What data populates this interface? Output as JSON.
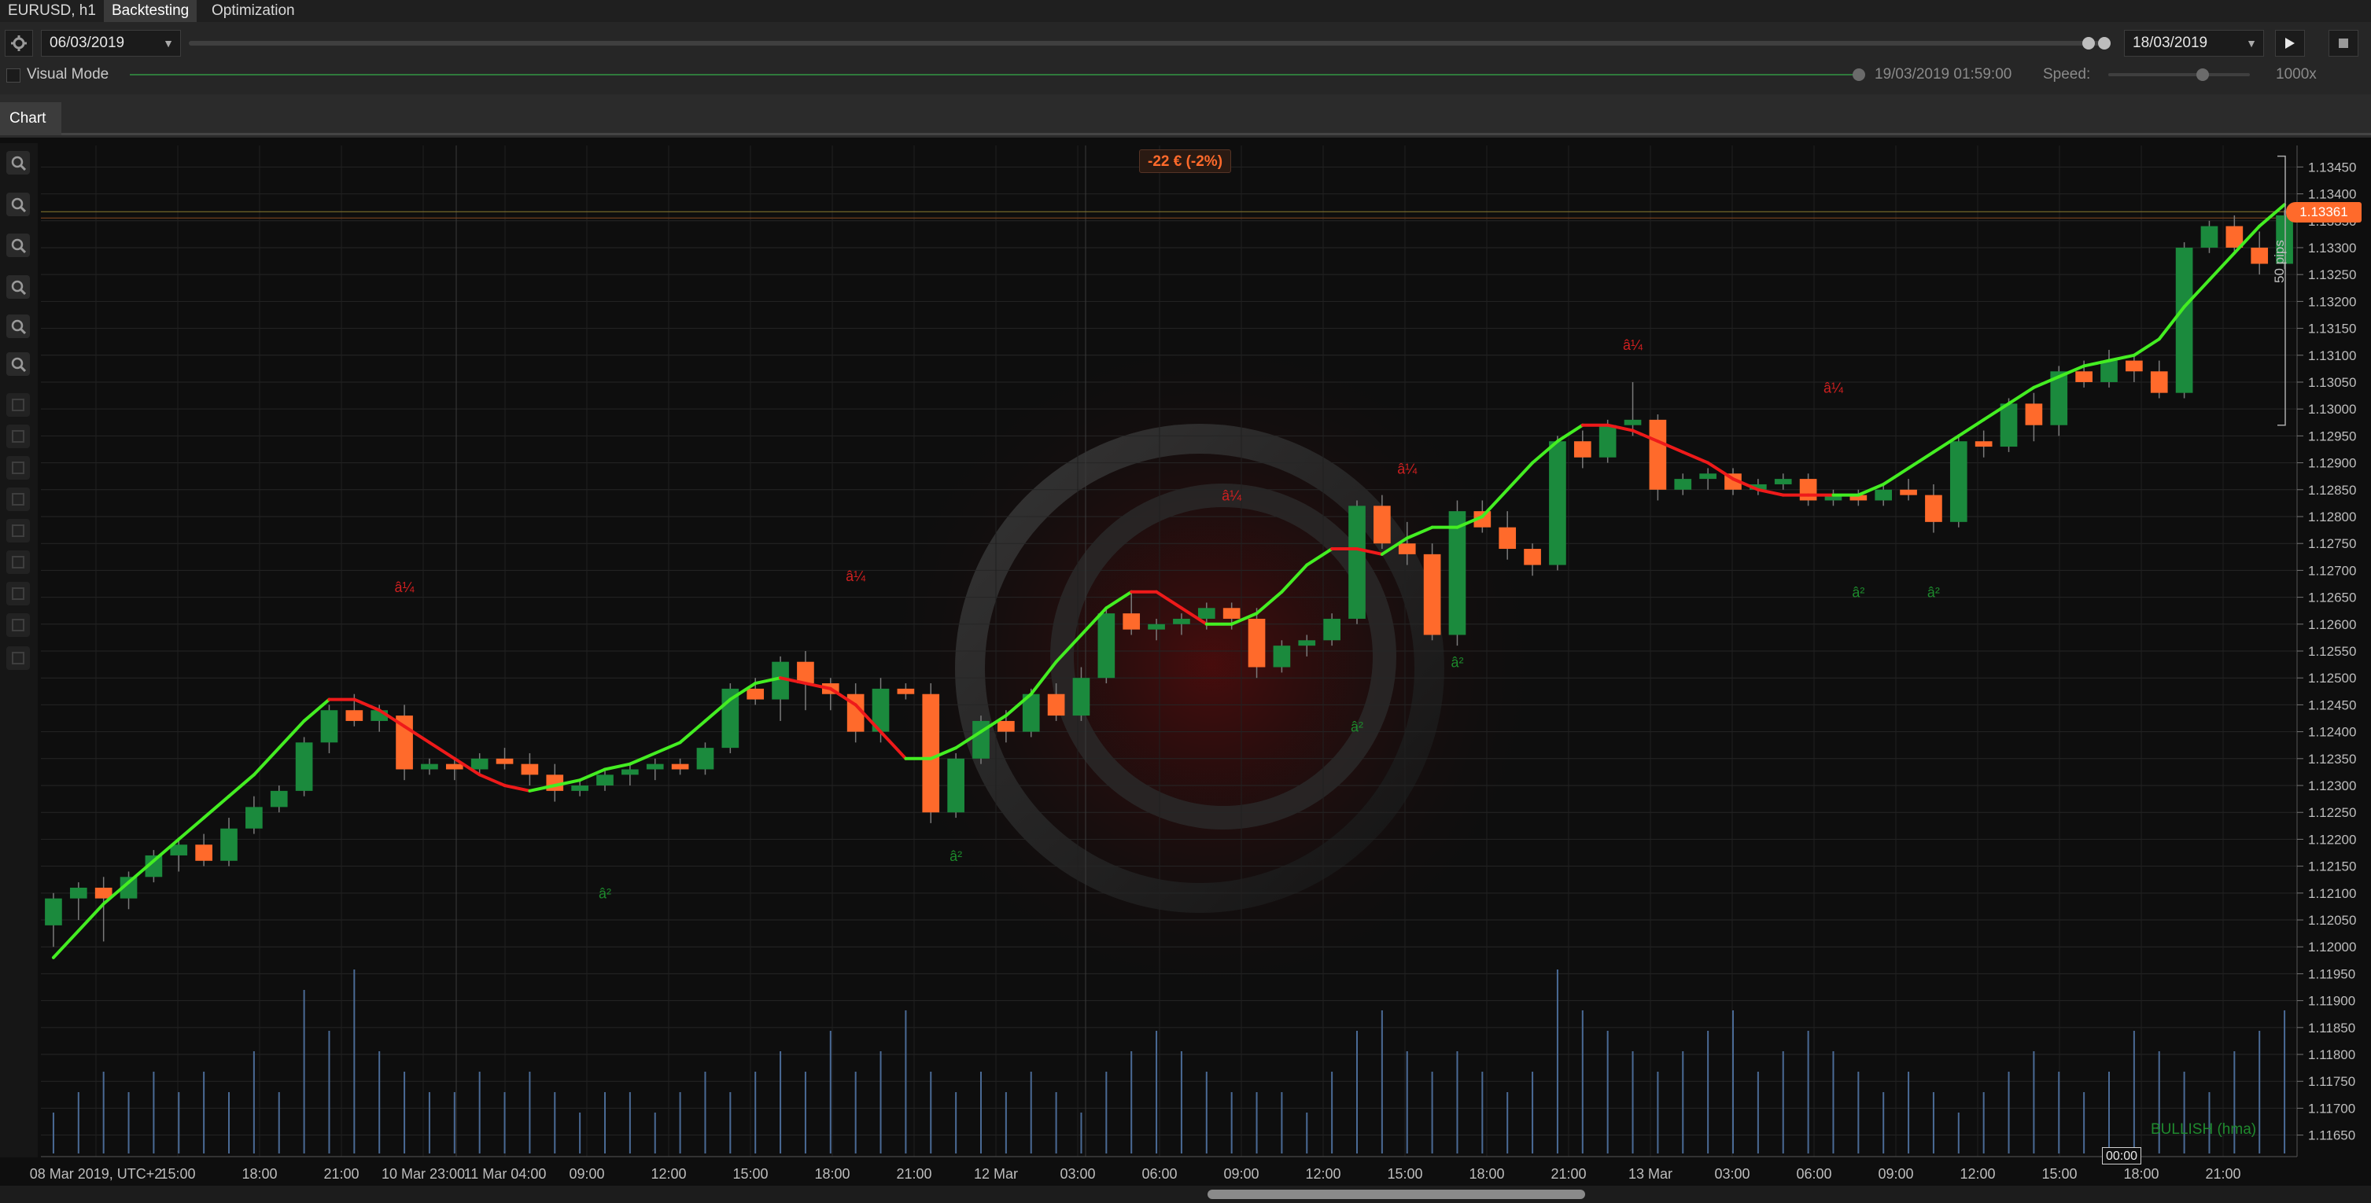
{
  "tabs": {
    "symbol": "EURUSD, h1",
    "backtesting": "Backtesting",
    "optimization": "Optimization"
  },
  "toolbar": {
    "start_date": "06/03/2019",
    "end_date": "18/03/2019",
    "visual_mode": "Visual Mode",
    "visual_mode_checked": false,
    "current_time": "19/03/2019 01:59:00",
    "speed_label": "Speed:",
    "speed_value": "1000x"
  },
  "chart_tab": "Chart",
  "pnl_badge": "-22 € (-2%)",
  "current_price": "1.13361",
  "range_label": "50 pips",
  "indicator_label": "BULLISH (hma)",
  "cursor_time": "00:00",
  "colors": {
    "bull": "#1b8a3d",
    "bear": "#ff6a2b",
    "hma_up": "#44ee22",
    "hma_down": "#ee1a1a",
    "price_badge": "#ff6a2b",
    "bg": "#0e0e0e"
  },
  "sidebar_icons": [
    "zoom-in-icon",
    "zoom-out-icon",
    "crosshair-icon",
    "period-icon",
    "objects-icon",
    "settings-icon",
    "m1-icon",
    "m5-icon",
    "m15-icon",
    "m30-icon",
    "h1-icon",
    "h4-icon",
    "d1-icon",
    "w1-icon",
    "mn-icon"
  ],
  "chart_data": {
    "type": "candlestick",
    "symbol": "EURUSD",
    "timeframe": "h1",
    "ylim": [
      1.1161,
      1.1349
    ],
    "y_ticks": [
      "1.13450",
      "1.13400",
      "1.13350",
      "1.13300",
      "1.13250",
      "1.13200",
      "1.13150",
      "1.13100",
      "1.13050",
      "1.13000",
      "1.12950",
      "1.12900",
      "1.12850",
      "1.12800",
      "1.12750",
      "1.12700",
      "1.12650",
      "1.12600",
      "1.12550",
      "1.12500",
      "1.12450",
      "1.12400",
      "1.12350",
      "1.12300",
      "1.12250",
      "1.12200",
      "1.12150",
      "1.12100",
      "1.12050",
      "1.12000",
      "1.11950",
      "1.11900",
      "1.11850",
      "1.11800",
      "1.11750",
      "1.11700",
      "1.11650"
    ],
    "x_labels": [
      "08 Mar 2019, UTC+2",
      "15:00",
      "18:00",
      "21:00",
      "10 Mar 23:00",
      "11 Mar 04:00",
      "09:00",
      "12:00",
      "15:00",
      "18:00",
      "21:00",
      "12 Mar",
      "03:00",
      "06:00",
      "09:00",
      "12:00",
      "15:00",
      "18:00",
      "21:00",
      "13 Mar",
      "03:00",
      "06:00",
      "09:00",
      "12:00",
      "15:00",
      "18:00",
      "21:00"
    ],
    "candles": [
      [
        1.1204,
        1.121,
        1.12,
        1.1209
      ],
      [
        1.1209,
        1.1212,
        1.1205,
        1.1211
      ],
      [
        1.1211,
        1.1213,
        1.1201,
        1.1209
      ],
      [
        1.1209,
        1.1214,
        1.1207,
        1.1213
      ],
      [
        1.1213,
        1.1218,
        1.1212,
        1.1217
      ],
      [
        1.1217,
        1.122,
        1.1214,
        1.1219
      ],
      [
        1.1219,
        1.1221,
        1.1215,
        1.1216
      ],
      [
        1.1216,
        1.1224,
        1.1215,
        1.1222
      ],
      [
        1.1222,
        1.1228,
        1.1221,
        1.1226
      ],
      [
        1.1226,
        1.123,
        1.1225,
        1.1229
      ],
      [
        1.1229,
        1.1239,
        1.1228,
        1.1238
      ],
      [
        1.1238,
        1.1245,
        1.1236,
        1.1244
      ],
      [
        1.1244,
        1.1247,
        1.1241,
        1.1242
      ],
      [
        1.1242,
        1.1245,
        1.124,
        1.1244
      ],
      [
        1.1243,
        1.1245,
        1.1231,
        1.1233
      ],
      [
        1.1233,
        1.1235,
        1.1232,
        1.1234
      ],
      [
        1.1234,
        1.1235,
        1.1231,
        1.1233
      ],
      [
        1.1233,
        1.1236,
        1.1232,
        1.1235
      ],
      [
        1.1235,
        1.1237,
        1.1233,
        1.1234
      ],
      [
        1.1234,
        1.1236,
        1.123,
        1.1232
      ],
      [
        1.1232,
        1.1234,
        1.1227,
        1.1229
      ],
      [
        1.1229,
        1.1231,
        1.1228,
        1.123
      ],
      [
        1.123,
        1.1233,
        1.1229,
        1.1232
      ],
      [
        1.1232,
        1.1234,
        1.123,
        1.1233
      ],
      [
        1.1233,
        1.1235,
        1.1231,
        1.1234
      ],
      [
        1.1234,
        1.1235,
        1.1232,
        1.1233
      ],
      [
        1.1233,
        1.1238,
        1.1232,
        1.1237
      ],
      [
        1.1237,
        1.1249,
        1.1236,
        1.1248
      ],
      [
        1.1248,
        1.125,
        1.1245,
        1.1246
      ],
      [
        1.1246,
        1.1254,
        1.1242,
        1.1253
      ],
      [
        1.1253,
        1.1255,
        1.1244,
        1.1249
      ],
      [
        1.1249,
        1.125,
        1.1244,
        1.1247
      ],
      [
        1.1247,
        1.1249,
        1.1238,
        1.124
      ],
      [
        1.124,
        1.125,
        1.1238,
        1.1248
      ],
      [
        1.1248,
        1.1249,
        1.1246,
        1.1247
      ],
      [
        1.1247,
        1.1249,
        1.1223,
        1.1225
      ],
      [
        1.1225,
        1.1236,
        1.1224,
        1.1235
      ],
      [
        1.1235,
        1.1243,
        1.1234,
        1.1242
      ],
      [
        1.1242,
        1.1244,
        1.1238,
        1.124
      ],
      [
        1.124,
        1.1248,
        1.1239,
        1.1247
      ],
      [
        1.1247,
        1.1249,
        1.1242,
        1.1243
      ],
      [
        1.1243,
        1.1252,
        1.1242,
        1.125
      ],
      [
        1.125,
        1.1263,
        1.1249,
        1.1262
      ],
      [
        1.1262,
        1.1266,
        1.1258,
        1.1259
      ],
      [
        1.1259,
        1.1261,
        1.1257,
        1.126
      ],
      [
        1.126,
        1.1262,
        1.1258,
        1.1261
      ],
      [
        1.1261,
        1.1264,
        1.1259,
        1.1263
      ],
      [
        1.1263,
        1.1264,
        1.1259,
        1.1261
      ],
      [
        1.1261,
        1.1263,
        1.125,
        1.1252
      ],
      [
        1.1252,
        1.1257,
        1.1251,
        1.1256
      ],
      [
        1.1256,
        1.1258,
        1.1254,
        1.1257
      ],
      [
        1.1257,
        1.1262,
        1.1256,
        1.1261
      ],
      [
        1.1261,
        1.1283,
        1.126,
        1.1282
      ],
      [
        1.1282,
        1.1284,
        1.1274,
        1.1275
      ],
      [
        1.1275,
        1.1279,
        1.1271,
        1.1273
      ],
      [
        1.1273,
        1.1275,
        1.1257,
        1.1258
      ],
      [
        1.1258,
        1.1283,
        1.1256,
        1.1281
      ],
      [
        1.1281,
        1.1283,
        1.1277,
        1.1278
      ],
      [
        1.1278,
        1.1281,
        1.1272,
        1.1274
      ],
      [
        1.1274,
        1.1275,
        1.1269,
        1.1271
      ],
      [
        1.1271,
        1.1295,
        1.127,
        1.1294
      ],
      [
        1.1294,
        1.1296,
        1.1289,
        1.1291
      ],
      [
        1.1291,
        1.1298,
        1.129,
        1.1297
      ],
      [
        1.1297,
        1.1305,
        1.1295,
        1.1298
      ],
      [
        1.1298,
        1.1299,
        1.1283,
        1.1285
      ],
      [
        1.1285,
        1.1288,
        1.1284,
        1.1287
      ],
      [
        1.1287,
        1.1289,
        1.1285,
        1.1288
      ],
      [
        1.1288,
        1.1289,
        1.1284,
        1.1285
      ],
      [
        1.1285,
        1.1287,
        1.1284,
        1.1286
      ],
      [
        1.1286,
        1.1288,
        1.1285,
        1.1287
      ],
      [
        1.1287,
        1.1288,
        1.1282,
        1.1283
      ],
      [
        1.1283,
        1.1285,
        1.1282,
        1.1284
      ],
      [
        1.1284,
        1.1285,
        1.1282,
        1.1283
      ],
      [
        1.1283,
        1.1286,
        1.1282,
        1.1285
      ],
      [
        1.1285,
        1.1287,
        1.1283,
        1.1284
      ],
      [
        1.1284,
        1.1286,
        1.1277,
        1.1279
      ],
      [
        1.1279,
        1.1295,
        1.1278,
        1.1294
      ],
      [
        1.1294,
        1.1296,
        1.1291,
        1.1293
      ],
      [
        1.1293,
        1.1302,
        1.1292,
        1.1301
      ],
      [
        1.1301,
        1.1303,
        1.1294,
        1.1297
      ],
      [
        1.1297,
        1.1308,
        1.1295,
        1.1307
      ],
      [
        1.1307,
        1.1309,
        1.1304,
        1.1305
      ],
      [
        1.1305,
        1.1311,
        1.1304,
        1.1309
      ],
      [
        1.1309,
        1.131,
        1.1305,
        1.1307
      ],
      [
        1.1307,
        1.1309,
        1.1302,
        1.1303
      ],
      [
        1.1303,
        1.1331,
        1.1302,
        1.133
      ],
      [
        1.133,
        1.1335,
        1.1329,
        1.1334
      ],
      [
        1.1334,
        1.1336,
        1.1329,
        1.133
      ],
      [
        1.133,
        1.1333,
        1.1325,
        1.1327
      ],
      [
        1.1327,
        1.1337,
        1.1326,
        1.1336
      ]
    ],
    "volume": [
      0.2,
      0.3,
      0.4,
      0.3,
      0.4,
      0.3,
      0.4,
      0.3,
      0.5,
      0.3,
      0.8,
      0.6,
      0.9,
      0.5,
      0.4,
      0.3,
      0.3,
      0.4,
      0.3,
      0.4,
      0.3,
      0.2,
      0.3,
      0.3,
      0.2,
      0.3,
      0.4,
      0.3,
      0.4,
      0.5,
      0.4,
      0.6,
      0.4,
      0.5,
      0.7,
      0.4,
      0.3,
      0.4,
      0.3,
      0.4,
      0.3,
      0.2,
      0.4,
      0.5,
      0.6,
      0.5,
      0.4,
      0.3,
      0.3,
      0.3,
      0.2,
      0.4,
      0.6,
      0.7,
      0.5,
      0.4,
      0.5,
      0.4,
      0.3,
      0.4,
      0.9,
      0.7,
      0.6,
      0.5,
      0.4,
      0.5,
      0.6,
      0.7,
      0.4,
      0.5,
      0.6,
      0.5,
      0.4,
      0.3,
      0.4,
      0.3,
      0.2,
      0.3,
      0.4,
      0.5,
      0.4,
      0.3,
      0.4,
      0.6,
      0.5,
      0.4,
      0.3,
      0.5,
      0.6,
      0.7
    ],
    "hma": [
      1.1198,
      1.1203,
      1.1208,
      1.1212,
      1.1216,
      1.122,
      1.1224,
      1.1228,
      1.1232,
      1.1237,
      1.1242,
      1.1246,
      1.1246,
      1.1244,
      1.1241,
      1.1238,
      1.1235,
      1.1232,
      1.123,
      1.1229,
      1.123,
      1.1231,
      1.1233,
      1.1234,
      1.1236,
      1.1238,
      1.1242,
      1.1246,
      1.1249,
      1.125,
      1.1249,
      1.1248,
      1.1245,
      1.124,
      1.1235,
      1.1235,
      1.1237,
      1.124,
      1.1243,
      1.1247,
      1.1253,
      1.1258,
      1.1263,
      1.1266,
      1.1266,
      1.1263,
      1.126,
      1.126,
      1.1262,
      1.1266,
      1.1271,
      1.1274,
      1.1274,
      1.1273,
      1.1276,
      1.1278,
      1.1278,
      1.128,
      1.1285,
      1.129,
      1.1294,
      1.1297,
      1.1297,
      1.1296,
      1.1294,
      1.1292,
      1.129,
      1.1287,
      1.1285,
      1.1284,
      1.1284,
      1.1284,
      1.1284,
      1.1286,
      1.1289,
      1.1292,
      1.1295,
      1.1298,
      1.1301,
      1.1304,
      1.1306,
      1.1308,
      1.1309,
      1.131,
      1.1313,
      1.1319,
      1.1324,
      1.1329,
      1.1334,
      1.1338
    ],
    "hma_up": [
      true,
      true,
      true,
      true,
      true,
      true,
      true,
      true,
      true,
      true,
      true,
      true,
      false,
      false,
      false,
      false,
      false,
      false,
      false,
      false,
      true,
      true,
      true,
      true,
      true,
      true,
      true,
      true,
      true,
      true,
      false,
      false,
      false,
      false,
      false,
      true,
      true,
      true,
      true,
      true,
      true,
      true,
      true,
      true,
      false,
      false,
      false,
      true,
      true,
      true,
      true,
      true,
      false,
      false,
      true,
      true,
      true,
      true,
      true,
      true,
      true,
      true,
      false,
      false,
      false,
      false,
      false,
      false,
      false,
      false,
      false,
      false,
      true,
      true,
      true,
      true,
      true,
      true,
      true,
      true,
      true,
      true,
      true,
      true,
      true,
      true,
      true,
      true,
      true,
      true
    ],
    "up_arrows": [
      [
        22,
        1.1209
      ],
      [
        36,
        1.1216
      ],
      [
        52,
        1.124
      ],
      [
        72,
        1.1265
      ],
      [
        75,
        1.1265
      ],
      [
        56,
        1.1252
      ]
    ],
    "down_arrows": [
      [
        14,
        1.1266
      ],
      [
        32,
        1.1268
      ],
      [
        47,
        1.1283
      ],
      [
        54,
        1.1288
      ],
      [
        63,
        1.1311
      ],
      [
        71,
        1.1303
      ]
    ],
    "marker_glyph_up": "â²",
    "marker_glyph_down": "â¼"
  }
}
